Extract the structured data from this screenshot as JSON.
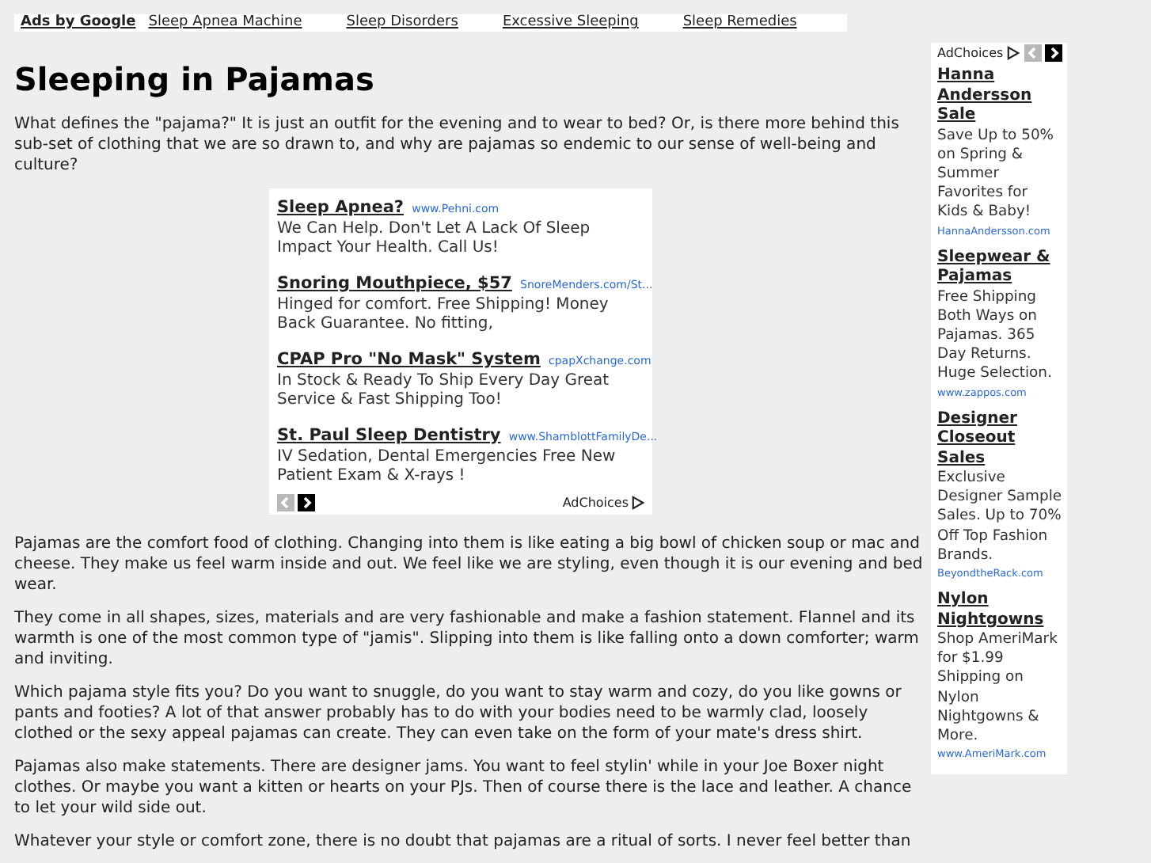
{
  "top_ads": {
    "label": "Ads by Google",
    "links": [
      {
        "text": "Sleep Apnea Machine"
      },
      {
        "text": "Sleep Disorders"
      },
      {
        "text": "Excessive Sleeping"
      },
      {
        "text": "Sleep Remedies"
      }
    ]
  },
  "article": {
    "title": "Sleeping in Pajamas",
    "intro": "What defines the \"pajama?\" It is just an outfit for the evening and to wear to bed? Or, is there more behind this sub-set of clothing that we are so drawn to, and why are pajamas so endemic to our sense of well-being and culture?",
    "paragraphs": [
      "Pajamas are the comfort food of clothing. Changing into them is like eating a big bowl of chicken soup or mac and cheese. They make us feel warm inside and out. We feel like we are styling, even though it is our evening and bed wear.",
      "They come in all shapes, sizes, materials and are very fashionable and make a fashion statement. Flannel and its warmth is one of the most common type of \"jamis\". Slipping into them is like falling onto a down comforter; warm and inviting.",
      "Which pajama style fits you? Do you want to snuggle, do you want to stay warm and cozy, do you like gowns or pants and footies? A lot of that answer probably has to do with your bodies need to be warmly clad, loosely clothed or the sexy appeal pajamas can create. They can even take on the form of your mate's dress shirt.",
      "Pajamas also make statements. There are designer jams. You want to feel stylin' while in your Joe Boxer night clothes. Or maybe you want a kitten or hearts on your PJs. Then of course there is the lace and leather. A chance to let your wild side out.",
      "Whatever your style or comfort zone, there is no doubt that pajamas are a ritual of sorts. I never feel better than"
    ]
  },
  "ad_unit": {
    "ads": [
      {
        "title": "Sleep Apnea?",
        "url": "www.Pehni.com",
        "text": "We Can Help. Don't Let A Lack Of Sleep Impact Your Health. Call Us!"
      },
      {
        "title": "Snoring Mouthpiece, $57",
        "url": "SnoreMenders.com/St...",
        "text": "Hinged for comfort. Free Shipping! Money Back Guarantee. No fitting,"
      },
      {
        "title": "CPAP Pro \"No Mask\" System",
        "url": "cpapXchange.com",
        "text": "In Stock & Ready To Ship Every Day Great Service & Fast Shipping Too!"
      },
      {
        "title": "St. Paul Sleep Dentistry",
        "url": "www.ShamblottFamilyDe...",
        "text": "IV Sedation, Dental Emergencies Free New Patient Exam & X-rays !"
      }
    ],
    "nav": [
      {
        "disabled": true
      },
      {
        "disabled": false
      }
    ],
    "adchoices": "AdChoices"
  },
  "sidebar_ad": {
    "adchoices": "AdChoices",
    "nav": [
      {
        "disabled": true
      },
      {
        "disabled": false
      }
    ],
    "ads": [
      {
        "title": "Hanna Andersson Sale",
        "text": "Save Up to 50% on Spring & Summer Favorites for Kids & Baby!",
        "url": "HannaAndersson.com"
      },
      {
        "title": "Sleepwear & Pajamas",
        "text": "Free Shipping Both Ways on Pajamas. 365 Day Returns. Huge Selection.",
        "url": "www.zappos.com"
      },
      {
        "title": "Designer Closeout Sales",
        "text": "Exclusive Designer Sample Sales. Up to 70% Off Top Fashion Brands.",
        "url": "BeyondtheRack.com"
      },
      {
        "title": "Nylon Nightgowns",
        "text": "Shop AmeriMark for $1.99 Shipping on Nylon Nightgowns & More.",
        "url": "www.AmeriMark.com"
      }
    ]
  }
}
